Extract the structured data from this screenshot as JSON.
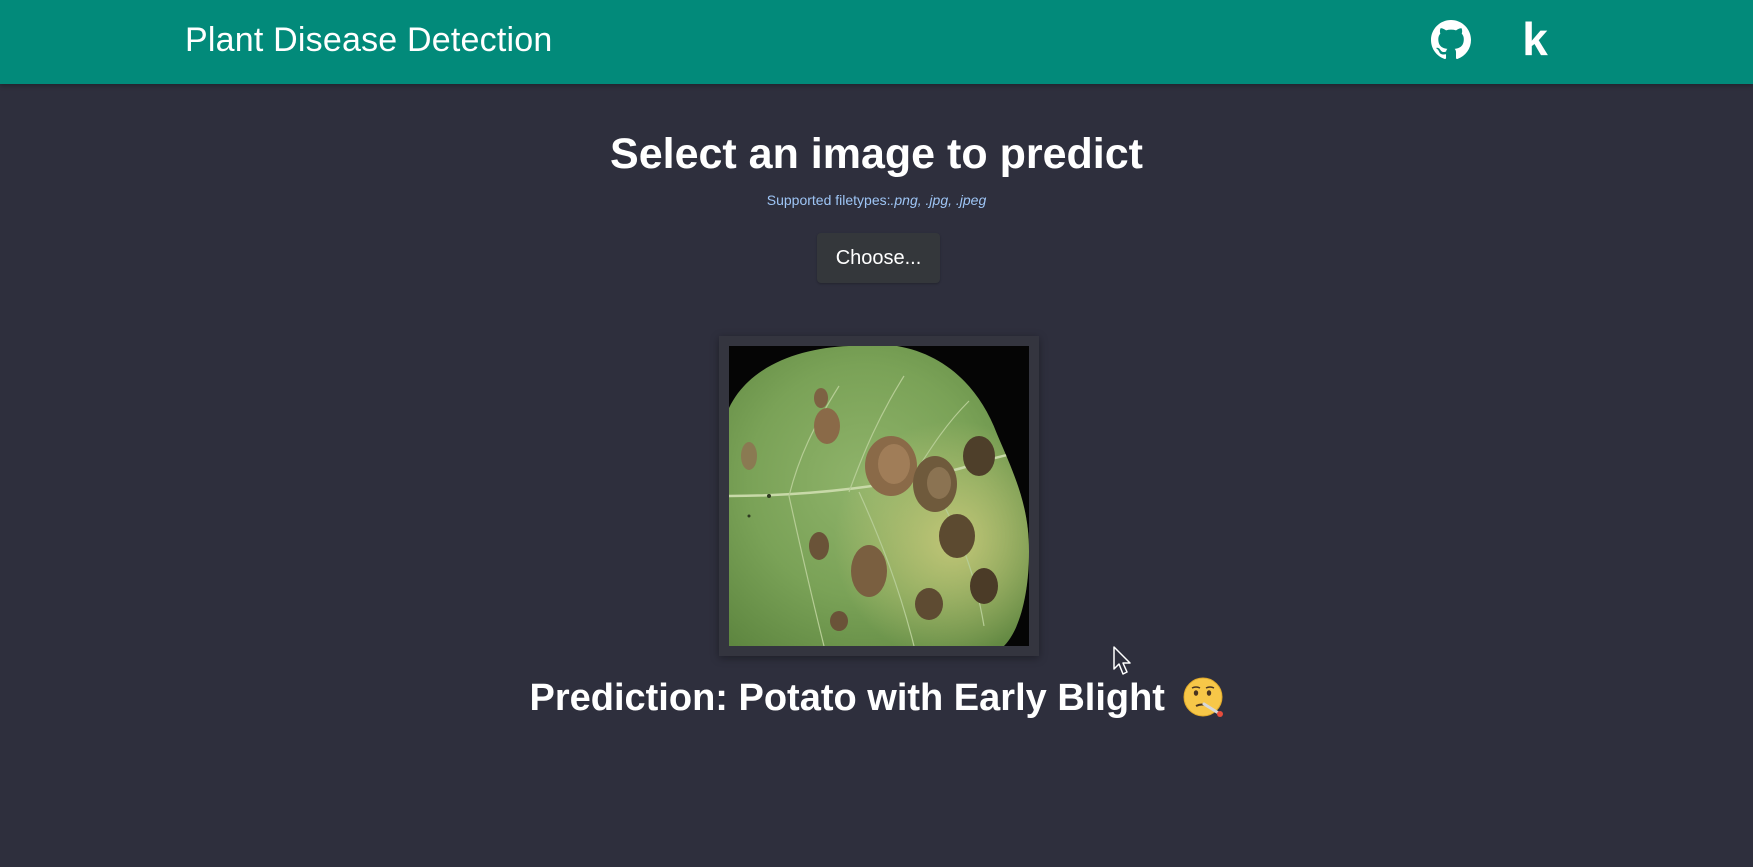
{
  "navbar": {
    "brand": "Plant Disease Detection",
    "icons": [
      "github-icon",
      "kaggle-icon"
    ],
    "kaggle_glyph": "k",
    "background": "#028a7a"
  },
  "upload": {
    "heading": "Select an image to predict",
    "filetypes_label": "Supported filetypes:",
    "filetypes_value": ".png, .jpg, .jpeg",
    "choose_label": "Choose..."
  },
  "prediction": {
    "text": "Prediction: Potato with Early Blight",
    "emoji": "face-with-thermometer"
  },
  "colors": {
    "page_background": "#2e2f3d",
    "accent": "#028a7a",
    "hint_text": "#9ec5f5"
  }
}
